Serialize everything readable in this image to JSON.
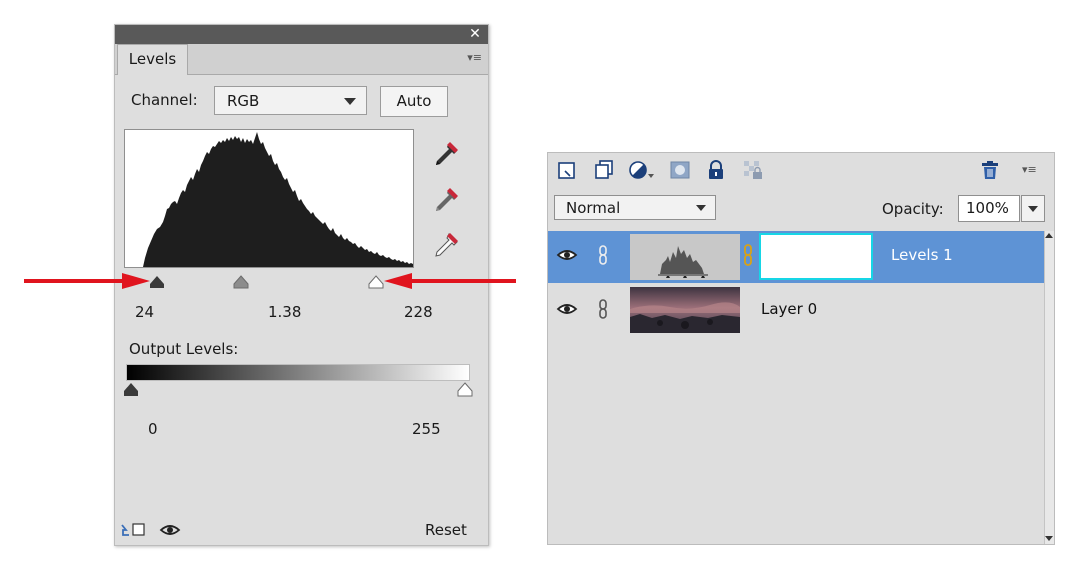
{
  "levels_panel": {
    "tab_label": "Levels",
    "channel_label": "Channel:",
    "channel_value": "RGB",
    "auto_label": "Auto",
    "input_levels": {
      "black": "24",
      "gamma": "1.38",
      "white": "228"
    },
    "output_label": "Output Levels:",
    "output_levels": {
      "black": "0",
      "white": "255"
    },
    "reset_label": "Reset",
    "icons": [
      "close-icon",
      "panel-menu-icon",
      "black-eyedropper-icon",
      "gray-eyedropper-icon",
      "white-eyedropper-icon",
      "clip-to-layer-icon",
      "visibility-eye-icon"
    ]
  },
  "annotation_color": "#e0141e",
  "layers_panel": {
    "toolbar_icons": [
      "new-layer-icon",
      "new-group-icon",
      "adjustment-layer-icon",
      "add-mask-icon",
      "lock-all-icon",
      "lock-transparency-icon",
      "delete-layer-icon",
      "panel-menu-icon"
    ],
    "blend_mode": "Normal",
    "opacity_label": "Opacity:",
    "opacity_value": "100%",
    "layers": [
      {
        "name": "Levels 1",
        "selected": true,
        "type": "adjustment"
      },
      {
        "name": "Layer 0",
        "selected": false,
        "type": "image"
      }
    ],
    "selection_color": "#5e93d5",
    "mask_border_color": "#16d6e6"
  }
}
